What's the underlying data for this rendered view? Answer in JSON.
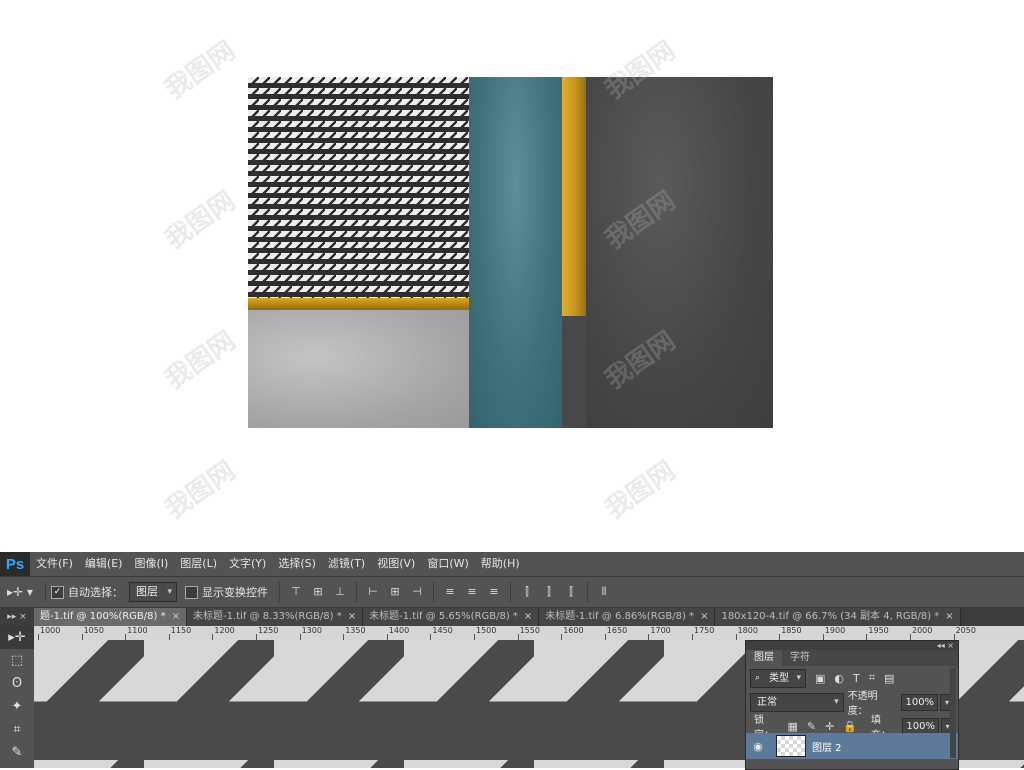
{
  "watermark": {
    "text": "我图网"
  },
  "menubar": {
    "logo": "Ps",
    "items": [
      "文件(F)",
      "编辑(E)",
      "图像(I)",
      "图层(L)",
      "文字(Y)",
      "选择(S)",
      "滤镜(T)",
      "视图(V)",
      "窗口(W)",
      "帮助(H)"
    ]
  },
  "options": {
    "tool": "▸✛ ▾",
    "auto_select_checked": "✓",
    "auto_select_label": "自动选择：",
    "auto_select_value": "图层",
    "show_transform_label": "显示变换控件",
    "align_icons": [
      "⊤",
      "⊞",
      "⊥",
      "⊢",
      "⊞",
      "⊣",
      "≡",
      "≡",
      "≡",
      "⫿",
      "⫿",
      "⫿",
      "⦀"
    ]
  },
  "tabs": [
    {
      "label": "题-1.tif @ 100%(RGB/8) *",
      "close": "×",
      "active": true
    },
    {
      "label": "未标题-1.tif @ 8.33%(RGB/8) *",
      "close": "×",
      "active": false
    },
    {
      "label": "未标题-1.tif @ 5.65%(RGB/8) *",
      "close": "×",
      "active": false
    },
    {
      "label": "未标题-1.tif @ 6.86%(RGB/8) *",
      "close": "×",
      "active": false
    },
    {
      "label": "180x120-4.tif @ 66.7% (34 副本 4, RGB/8) *",
      "close": "×",
      "active": false
    }
  ],
  "tab_arrows": "▸▸ ×",
  "ruler": [
    "1000",
    "1050",
    "1100",
    "1150",
    "1200",
    "1250",
    "1300",
    "1350",
    "1400",
    "1450",
    "1500",
    "1550",
    "1600",
    "1650",
    "1700",
    "1750",
    "1800",
    "1850",
    "1900",
    "1950",
    "2000",
    "2050"
  ],
  "tools": [
    "▸✛",
    "⬚",
    "ʘ",
    "✦",
    "⌗",
    "✎"
  ],
  "layers_panel": {
    "top_controls": "◂◂ ×",
    "tabs": [
      "图层",
      "字符"
    ],
    "filter_label": "类型",
    "filter_lead": "⌕",
    "filter_icons": [
      "▣",
      "◐",
      "T",
      "⌗",
      "▤"
    ],
    "blend_mode": "正常",
    "opacity_label": "不透明度：",
    "opacity_value": "100%",
    "lock_label": "锁定：",
    "lock_icons": [
      "▦",
      "✎",
      "✛",
      "🔒"
    ],
    "fill_label": "填充：",
    "fill_value": "100%",
    "layer": {
      "eye": "◉",
      "name": "图层 2"
    }
  }
}
